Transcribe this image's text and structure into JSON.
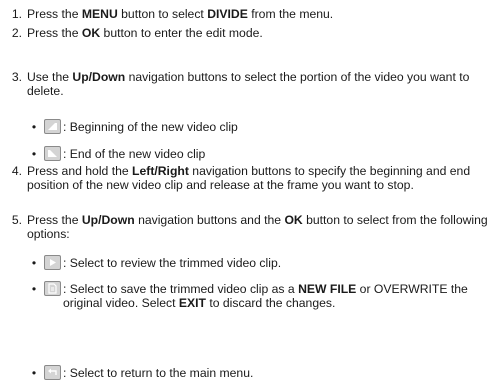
{
  "steps": [
    {
      "num": "1.",
      "parts": [
        {
          "t": "Press the "
        },
        {
          "t": "MENU",
          "b": true
        },
        {
          "t": " button to select "
        },
        {
          "t": "DIVIDE",
          "b": true
        },
        {
          "t": " from the menu."
        }
      ]
    },
    {
      "num": "2.",
      "parts": [
        {
          "t": "Press the "
        },
        {
          "t": "OK",
          "b": true
        },
        {
          "t": " button to enter the edit mode."
        }
      ]
    },
    {
      "num": "3.",
      "parts": [
        {
          "t": "Use the "
        },
        {
          "t": "Up/Down",
          "b": true
        },
        {
          "t": " navigation buttons to select the portion of the video you want to delete."
        }
      ]
    },
    {
      "num": "4.",
      "parts": [
        {
          "t": "Press and hold the "
        },
        {
          "t": "Left/Right",
          "b": true
        },
        {
          "t": " navigation buttons to specify the beginning and end position of the new video clip and release at the frame you want to stop."
        }
      ]
    },
    {
      "num": "5.",
      "parts": [
        {
          "t": "Press the "
        },
        {
          "t": "Up/Down",
          "b": true
        },
        {
          "t": " navigation buttons and the "
        },
        {
          "t": "OK",
          "b": true
        },
        {
          "t": " button to select from the following options:"
        }
      ]
    }
  ],
  "step3_bullets": [
    {
      "icon": "clip-beginning-icon",
      "parts": [
        {
          "t": ": Beginning of the new video clip"
        }
      ]
    },
    {
      "icon": "clip-end-icon",
      "parts": [
        {
          "t": ": End of the new video clip"
        }
      ]
    }
  ],
  "step5_bullets": [
    {
      "icon": "play-icon",
      "parts": [
        {
          "t": ": Select to review the trimmed video clip."
        }
      ]
    },
    {
      "icon": "save-icon",
      "parts": [
        {
          "t": ": Select to save the trimmed video clip as a "
        },
        {
          "t": "NEW FILE",
          "b": true
        },
        {
          "t": " or OVERWRITE the original video. Select "
        },
        {
          "t": "EXIT",
          "b": true
        },
        {
          "t": " to discard the changes."
        }
      ]
    },
    {
      "icon": "return-icon",
      "parts": [
        {
          "t": ": Select to return to the main menu."
        }
      ]
    }
  ],
  "bullet_char": "•"
}
